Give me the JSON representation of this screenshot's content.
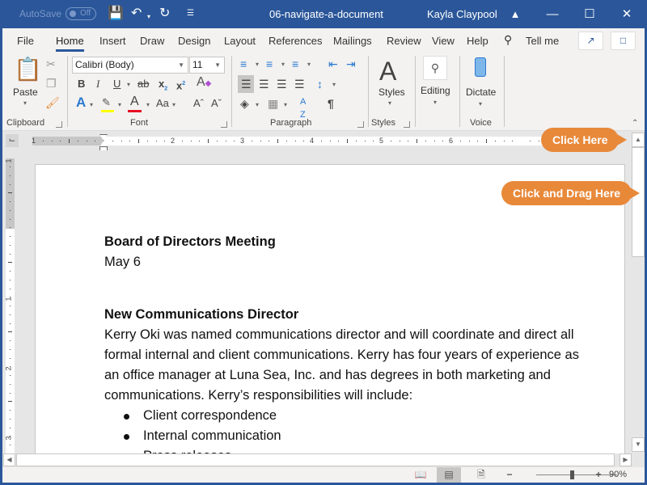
{
  "titlebar": {
    "autosave_label": "AutoSave",
    "autosave_state": "Off",
    "doc_title": "06-navigate-a-document",
    "user_name": "Kayla Claypool"
  },
  "tabs": [
    {
      "label": "File",
      "active": false
    },
    {
      "label": "Home",
      "active": true
    },
    {
      "label": "Insert",
      "active": false
    },
    {
      "label": "Draw",
      "active": false
    },
    {
      "label": "Design",
      "active": false
    },
    {
      "label": "Layout",
      "active": false
    },
    {
      "label": "References",
      "active": false
    },
    {
      "label": "Mailings",
      "active": false
    },
    {
      "label": "Review",
      "active": false
    },
    {
      "label": "View",
      "active": false
    },
    {
      "label": "Help",
      "active": false
    }
  ],
  "tell_me": "Tell me",
  "ribbon": {
    "clipboard": {
      "label": "Clipboard",
      "paste": "Paste"
    },
    "font": {
      "label": "Font",
      "font_name": "Calibri (Body)",
      "font_size": "11",
      "change_case": "Aa",
      "colors": {
        "highlight": "#ffff00",
        "font_color": "#e81123"
      }
    },
    "paragraph": {
      "label": "Paragraph"
    },
    "styles": {
      "label": "Styles",
      "button": "Styles"
    },
    "editing": {
      "button": "Editing"
    },
    "voice": {
      "label": "Voice",
      "button": "Dictate"
    }
  },
  "ruler": {
    "h_numbers": [
      "1",
      "1",
      "2",
      "3",
      "4",
      "5",
      "6"
    ],
    "v_numbers": [
      "1",
      "1",
      "2",
      "3"
    ]
  },
  "document": {
    "heading1": "Board of Directors Meeting",
    "date": "May 6",
    "heading2": "New Communications Director",
    "paragraph_lines": [
      "Kerry Oki was named communications director and will coordinate and direct all",
      "formal internal and client communications. Kerry has four years of experience as",
      "an office manager at Luna Sea, Inc. and has degrees in both marketing and",
      "communications. Kerry’s responsibilities will include:"
    ],
    "bullets": [
      "Client correspondence",
      "Internal communication",
      "Press releases"
    ]
  },
  "callouts": {
    "click_here": "Click Here",
    "click_drag_here": "Click and Drag Here",
    "color": "#e8893a"
  },
  "statusbar": {
    "zoom_level": "90%",
    "zoom_percent": 90,
    "active_view": "print-layout"
  },
  "theme": {
    "brand": "#2b579a"
  }
}
